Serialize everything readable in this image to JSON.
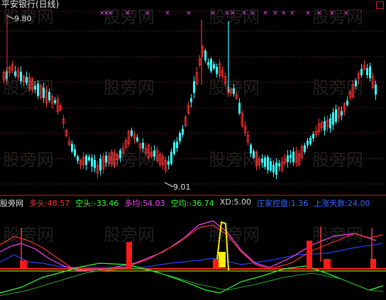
{
  "main_chart": {
    "title": "平安银行(日线)",
    "high_label": "9.80",
    "low_label": "9.01"
  },
  "indicator": {
    "name": "股旁网",
    "items": [
      {
        "label": "多头:",
        "value": "48.57",
        "color": "#ff3333"
      },
      {
        "label": "空头:",
        "value": "-33.46",
        "color": "#33ff33"
      },
      {
        "label": "多均:",
        "value": "54.03",
        "color": "#ff44ff"
      },
      {
        "label": "空均:",
        "value": "-36.74",
        "color": "#33ff33"
      },
      {
        "label": "XD:",
        "value": "5.00",
        "color": "#dddddd"
      },
      {
        "label": "庄家控盘:",
        "value": "1.36",
        "color": "#3366ff"
      },
      {
        "label": "上涨天数:",
        "value": "24.00",
        "color": "#3366ff"
      }
    ]
  },
  "watermark": "股旁网",
  "colors": {
    "up": "#ff3333",
    "down": "#33ffff",
    "marker": "#ff44ff",
    "grid": "#aa2222"
  }
}
